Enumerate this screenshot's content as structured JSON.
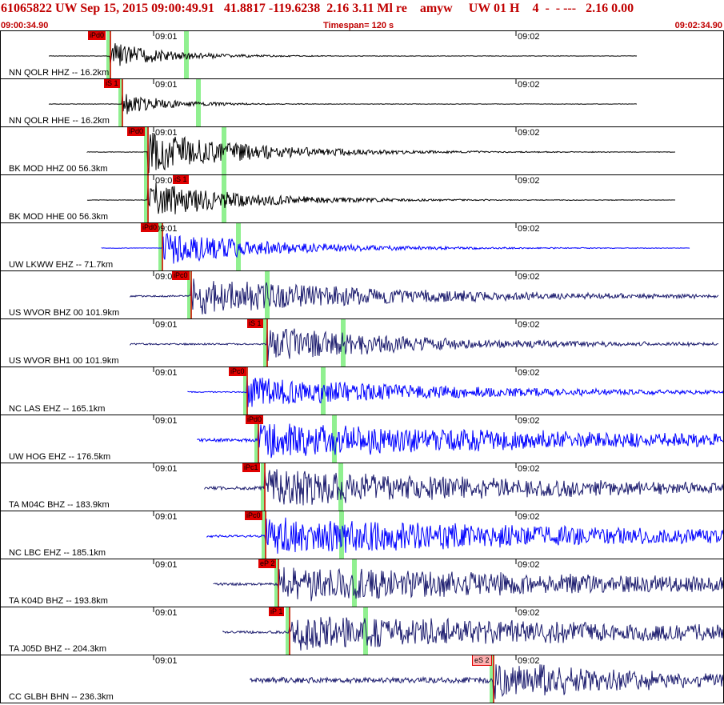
{
  "header": {
    "title": "61065822 UW Sep 15, 2015 09:00:49.91   41.8817 -119.6238  2.16 3.11 Ml re    amyw     UW 01 H    4  -  - ---   2.16 0.00",
    "start_time": "09:00:34.90",
    "timespan": "Timespan= 120 s",
    "end_time": "09:02:34.90"
  },
  "ticks": [
    "09:01",
    "09:02"
  ],
  "colors": {
    "black": "#000000",
    "blue": "#0000ff",
    "navy": "#1c1c6e",
    "pick": "#e00000",
    "window": "#90f090"
  },
  "panels": [
    {
      "label": "NN QOLR HHZ -- 16.2km",
      "color": "black",
      "start": 60,
      "end": 795,
      "onset": 137,
      "amp": 18,
      "decay": 70,
      "pick": "iPd0",
      "pickx": 109,
      "noise": 0.6
    },
    {
      "label": "NN QOLR HHE -- 16.2km",
      "color": "black",
      "start": 60,
      "end": 795,
      "onset": 152,
      "amp": 14,
      "decay": 60,
      "pick": "iS 1",
      "pickx": 129,
      "noise": 0.6
    },
    {
      "label": "BK MOD HHZ 00 56.3km",
      "color": "black",
      "start": 108,
      "end": 843,
      "onset": 184,
      "amp": 26,
      "decay": 130,
      "pick": "iPd0",
      "pickx": 158,
      "noise": 0.6
    },
    {
      "label": "BK MOD HHE 00 56.3km",
      "color": "black",
      "start": 108,
      "end": 843,
      "onset": 184,
      "amp": 24,
      "decay": 120,
      "pick": "iS 1",
      "pickx": 215,
      "noise": 0.6
    },
    {
      "label": "UW LKWW EHZ -- 71.7km",
      "color": "blue",
      "start": 126,
      "end": 861,
      "onset": 202,
      "amp": 22,
      "decay": 140,
      "pick": "iPd0",
      "pickx": 175,
      "noise": 0.5
    },
    {
      "label": "US WVOR BHZ 00 101.9km",
      "color": "navy",
      "start": 162,
      "end": 897,
      "onset": 238,
      "amp": 24,
      "decay": 260,
      "pick": "iPc0",
      "pickx": 214,
      "noise": 2
    },
    {
      "label": "US WVOR BH1 00 101.9km",
      "color": "navy",
      "start": 162,
      "end": 897,
      "onset": 333,
      "amp": 22,
      "decay": 200,
      "pick": "iS 1",
      "pickx": 308,
      "noise": 2
    },
    {
      "label": "NC LAS EHZ -- 165.1km",
      "color": "blue",
      "start": 234,
      "end": 903,
      "onset": 308,
      "amp": 20,
      "decay": 250,
      "pick": "iPc0",
      "pickx": 285,
      "noise": 1.5
    },
    {
      "label": "UW HOG EHZ -- 176.5km",
      "color": "blue",
      "start": 246,
      "end": 903,
      "onset": 322,
      "amp": 22,
      "decay": 500,
      "pick": "iPd0",
      "pickx": 306,
      "noise": 4
    },
    {
      "label": "TA M04C BHZ -- 183.9km",
      "color": "navy",
      "start": 255,
      "end": 903,
      "onset": 330,
      "amp": 24,
      "decay": 400,
      "pick": "iPc1",
      "pickx": 302,
      "noise": 4
    },
    {
      "label": "NC LBC EHZ -- 185.1km",
      "color": "blue",
      "start": 258,
      "end": 903,
      "onset": 331,
      "amp": 24,
      "decay": 500,
      "pick": "iPc0",
      "pickx": 305,
      "noise": 3
    },
    {
      "label": "TA K04D BHZ -- 193.8km",
      "color": "navy",
      "start": 266,
      "end": 903,
      "onset": 347,
      "amp": 22,
      "decay": 600,
      "pick": "eP 2",
      "pickx": 322,
      "noise": 3
    },
    {
      "label": "TA J05D BHZ -- 204.3km",
      "color": "navy",
      "start": 278,
      "end": 903,
      "onset": 361,
      "amp": 22,
      "decay": 600,
      "pick": "iP 1",
      "pickx": 335,
      "noise": 3
    },
    {
      "label": "CC GLBH BHN -- 236.3km",
      "color": "navy",
      "start": 312,
      "end": 903,
      "onset": 616,
      "amp": 24,
      "decay": 200,
      "pick": "eS 2",
      "pickx": 589,
      "noise": 7
    }
  ]
}
